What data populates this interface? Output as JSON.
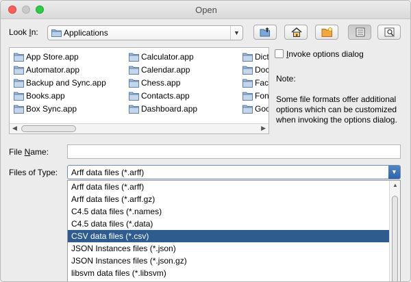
{
  "window": {
    "title": "Open"
  },
  "look_in": {
    "label_prefix": "Look ",
    "label_mnemonic": "I",
    "label_suffix": "n:",
    "value": "Applications"
  },
  "toolbar": {
    "icons": [
      "up-folder-icon",
      "home-icon",
      "new-folder-icon",
      "list-view-icon",
      "details-view-icon"
    ]
  },
  "files": {
    "columns": [
      [
        "App Store.app",
        "Automator.app",
        "Backup and Sync.app",
        "Books.app",
        "Box Sync.app"
      ],
      [
        "Calculator.app",
        "Calendar.app",
        "Chess.app",
        "Contacts.app",
        "Dashboard.app"
      ],
      [
        "Dict",
        "Doc",
        "Face",
        "Font",
        "Goo"
      ]
    ]
  },
  "options": {
    "invoke_label_mnemonic": "I",
    "invoke_label_rest": "nvoke options dialog",
    "invoke_checked": false,
    "note_title": "Note:",
    "note_text": "Some file formats offer additional options which can be customized when invoking the options dialog."
  },
  "file_name": {
    "label_prefix": "File ",
    "label_mnemonic": "N",
    "label_suffix": "ame:",
    "value": ""
  },
  "files_of_type": {
    "label": "Files of Type:",
    "selected": "Arff data files (*.arff)",
    "options": [
      "Arff data files (*.arff)",
      "Arff data files (*.arff.gz)",
      "C4.5 data files (*.names)",
      "C4.5 data files (*.data)",
      "CSV data files (*.csv)",
      "JSON Instances files (*.json)",
      "JSON Instances files (*.json.gz)",
      "libsvm data files (*.libsvm)"
    ],
    "highlighted_index": 4
  }
}
